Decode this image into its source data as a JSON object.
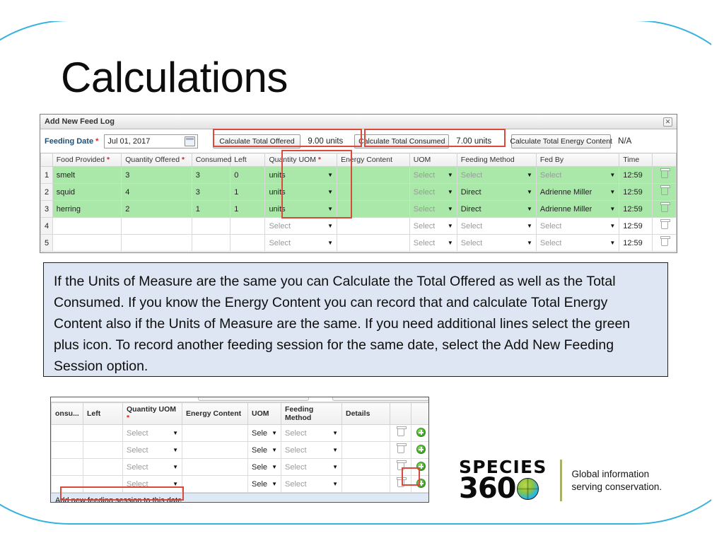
{
  "slide": {
    "title": "Calculations",
    "accent_color": "#36b3dd",
    "annotation_color": "#d94a3d"
  },
  "feed_log": {
    "window_title": "Add New Feed Log",
    "close_icon": "close-icon",
    "calendar_icon": "calendar-icon",
    "feeding_date_label": "Feeding Date",
    "required_marker": "*",
    "feeding_date_value": "Jul 01, 2017",
    "calculate_total_offered_label": "Calculate Total Offered",
    "total_offered_value": "9.00 units",
    "calculate_total_consumed_label": "Calculate Total Consumed",
    "total_consumed_value": "7.00 units",
    "calculate_total_energy_label": "Calculate Total Energy Content",
    "total_energy_value": "N/A",
    "columns": [
      "Food Provided",
      "Quantity Offered",
      "Consumed",
      "Left",
      "Quantity UOM",
      "Energy Content",
      "UOM",
      "Feeding Method",
      "Fed By",
      "Time"
    ],
    "required_columns": [
      "Food Provided",
      "Quantity Offered",
      "Quantity UOM"
    ],
    "select_placeholder": "Select",
    "rows": [
      {
        "n": "1",
        "food": "smelt",
        "offered": "3",
        "consumed": "3",
        "left": "0",
        "uom": "units",
        "energy": "",
        "energy_uom": "Select",
        "method": "Select",
        "fed_by": "Select",
        "time": "12:59",
        "filled": true
      },
      {
        "n": "2",
        "food": "squid",
        "offered": "4",
        "consumed": "3",
        "left": "1",
        "uom": "units",
        "energy": "",
        "energy_uom": "Select",
        "method": "Direct",
        "fed_by": "Adrienne Miller",
        "time": "12:59",
        "filled": true
      },
      {
        "n": "3",
        "food": "herring",
        "offered": "2",
        "consumed": "1",
        "left": "1",
        "uom": "units",
        "energy": "",
        "energy_uom": "Select",
        "method": "Direct",
        "fed_by": "Adrienne Miller",
        "time": "12:59",
        "filled": true
      },
      {
        "n": "4",
        "food": "",
        "offered": "",
        "consumed": "",
        "left": "",
        "uom": "Select",
        "energy": "",
        "energy_uom": "Select",
        "method": "Select",
        "fed_by": "Select",
        "time": "12:59",
        "filled": false
      },
      {
        "n": "5",
        "food": "",
        "offered": "",
        "consumed": "",
        "left": "",
        "uom": "Select",
        "energy": "",
        "energy_uom": "Select",
        "method": "Select",
        "fed_by": "Select",
        "time": "12:59",
        "filled": false
      }
    ]
  },
  "note": {
    "text": "If the Units of Measure are the same you can Calculate the Total Offered as well as the Total Consumed. If you know the Energy Content you can record that and calculate Total Energy Content also if the Units of Measure are the same. If you need additional lines select the green plus icon. To record another feeding session for the same date, select the Add New Feeding Session option."
  },
  "bottom_grid": {
    "columns": [
      "onsu...",
      "Left",
      "Quantity UOM",
      "Energy Content",
      "UOM",
      "Feeding Method",
      "Details"
    ],
    "required_columns": [
      "Quantity UOM"
    ],
    "select_placeholder": "Select",
    "select_truncated": "Sele",
    "rows": [
      {
        "uom": "Select",
        "energy_uom": "Sele",
        "method": "Select",
        "highlighted_plus": false
      },
      {
        "uom": "Select",
        "energy_uom": "Sele",
        "method": "Select",
        "highlighted_plus": false
      },
      {
        "uom": "Select",
        "energy_uom": "Sele",
        "method": "Select",
        "highlighted_plus": false
      },
      {
        "uom": "Select",
        "energy_uom": "Sele",
        "method": "Select",
        "highlighted_plus": true
      }
    ],
    "add_session_label": "Add new feeding session to this date",
    "delete_icon": "trash-icon",
    "add_icon": "plus-icon"
  },
  "logo": {
    "word_species": "SPECIES",
    "word_360": "360",
    "globe_icon": "globe-icon",
    "tagline_line1": "Global information",
    "tagline_line2": "serving conservation."
  }
}
